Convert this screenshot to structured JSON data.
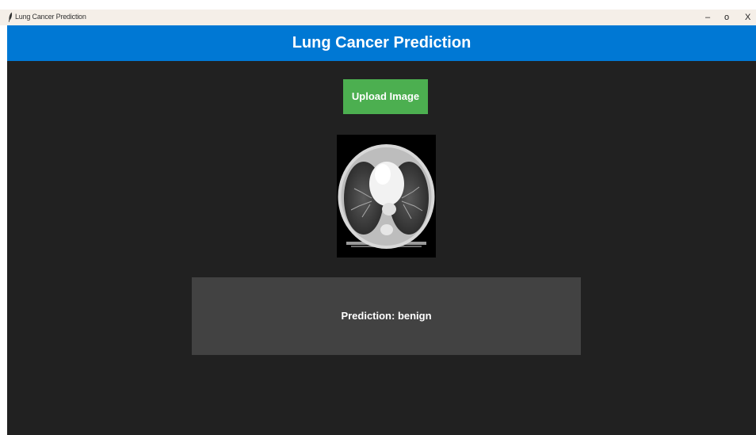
{
  "window": {
    "title": "Lung Cancer Prediction",
    "controls": {
      "minimize": "–",
      "maximize": "o",
      "close": "X"
    },
    "icon": "feather-icon"
  },
  "header": {
    "title": "Lung Cancer Prediction"
  },
  "main": {
    "upload_button_label": "Upload Image",
    "image_icon": "ct-scan-image",
    "prediction_text": "Prediction: benign"
  },
  "colors": {
    "header_bg": "#0078d4",
    "content_bg": "#212121",
    "button_bg": "#4caf50",
    "panel_bg": "#424242"
  }
}
